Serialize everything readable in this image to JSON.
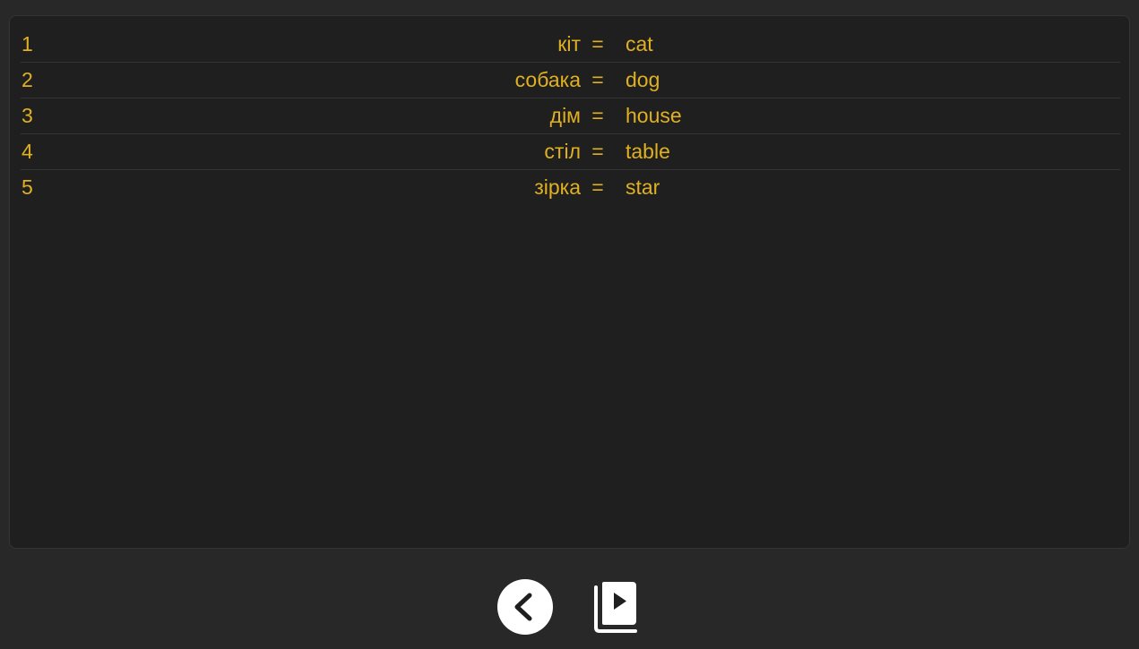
{
  "vocabulary": {
    "rows": [
      {
        "number": "1",
        "word": "кіт",
        "separator": "=",
        "translation": "cat"
      },
      {
        "number": "2",
        "word": "собака",
        "separator": "=",
        "translation": "dog"
      },
      {
        "number": "3",
        "word": "дім",
        "separator": "=",
        "translation": "house"
      },
      {
        "number": "4",
        "word": "стіл",
        "separator": "=",
        "translation": "table"
      },
      {
        "number": "5",
        "word": "зірка",
        "separator": "=",
        "translation": "star"
      }
    ]
  },
  "toolbar": {
    "back_icon": "chevron-left-icon",
    "library_icon": "video-library-icon"
  },
  "colors": {
    "text_accent": "#e0b022",
    "background": "#282828",
    "panel": "#1f1f1f",
    "button": "#ffffff"
  }
}
